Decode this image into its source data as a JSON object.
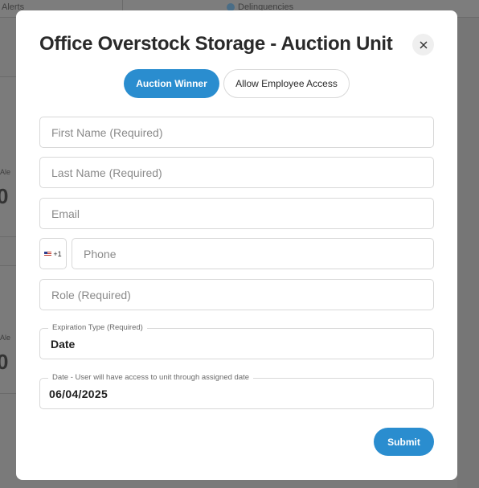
{
  "background": {
    "top_left_text": "Alerts",
    "top_center_text": "Delinquencies",
    "card_label_1": "Ale",
    "card_label_2": "Ale",
    "card_number_1": "0",
    "card_number_2": "0"
  },
  "modal": {
    "title": "Office Overstock Storage - Auction Unit",
    "close_icon": "close-icon",
    "tabs": [
      {
        "label": "Auction Winner",
        "active": true
      },
      {
        "label": "Allow Employee Access",
        "active": false
      }
    ],
    "form": {
      "first_name": {
        "placeholder": "First Name (Required)",
        "value": ""
      },
      "last_name": {
        "placeholder": "Last Name (Required)",
        "value": ""
      },
      "email": {
        "placeholder": "Email",
        "value": ""
      },
      "phone_country_code": "+1",
      "phone_flag_icon": "us-flag-icon",
      "phone": {
        "placeholder": "Phone",
        "value": ""
      },
      "role": {
        "placeholder": "Role (Required)",
        "value": ""
      },
      "expiration_type": {
        "label": "Expiration Type (Required)",
        "value": "Date"
      },
      "date": {
        "label": "Date - User will have access to unit through assigned date",
        "value": "06/04/2025"
      }
    },
    "submit_label": "Submit"
  },
  "colors": {
    "accent": "#2a8dcf",
    "overlay": "#7a7a7a"
  }
}
